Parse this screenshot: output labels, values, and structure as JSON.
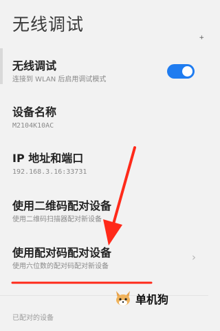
{
  "page": {
    "title": "无线调试"
  },
  "wireless_debug": {
    "title": "无线调试",
    "subtitle": "连接到 WLAN 后启用调试模式",
    "enabled": true
  },
  "device_name": {
    "title": "设备名称",
    "value": "M2104K10AC"
  },
  "ip_port": {
    "title": "IP 地址和端口",
    "value": "192.168.3.16:33731"
  },
  "qr_pair": {
    "title": "使用二维码配对设备",
    "subtitle": "使用二维码扫描器配对新设备"
  },
  "code_pair": {
    "title": "使用配对码配对设备",
    "subtitle": "使用六位数的配对码配对新设备"
  },
  "paired_devices": {
    "label": "已配对的设备"
  },
  "watermark": {
    "text": "单机狗"
  },
  "annotation": {
    "arrow_color": "#ff2a1a",
    "corner_mark": "+"
  },
  "colors": {
    "accent": "#1f7cf0",
    "background": "#f2f2f2",
    "annotation_red": "#ff2a1a"
  },
  "icons": {
    "chevron": "chevron-right-icon",
    "logo": "fox-logo-icon"
  }
}
